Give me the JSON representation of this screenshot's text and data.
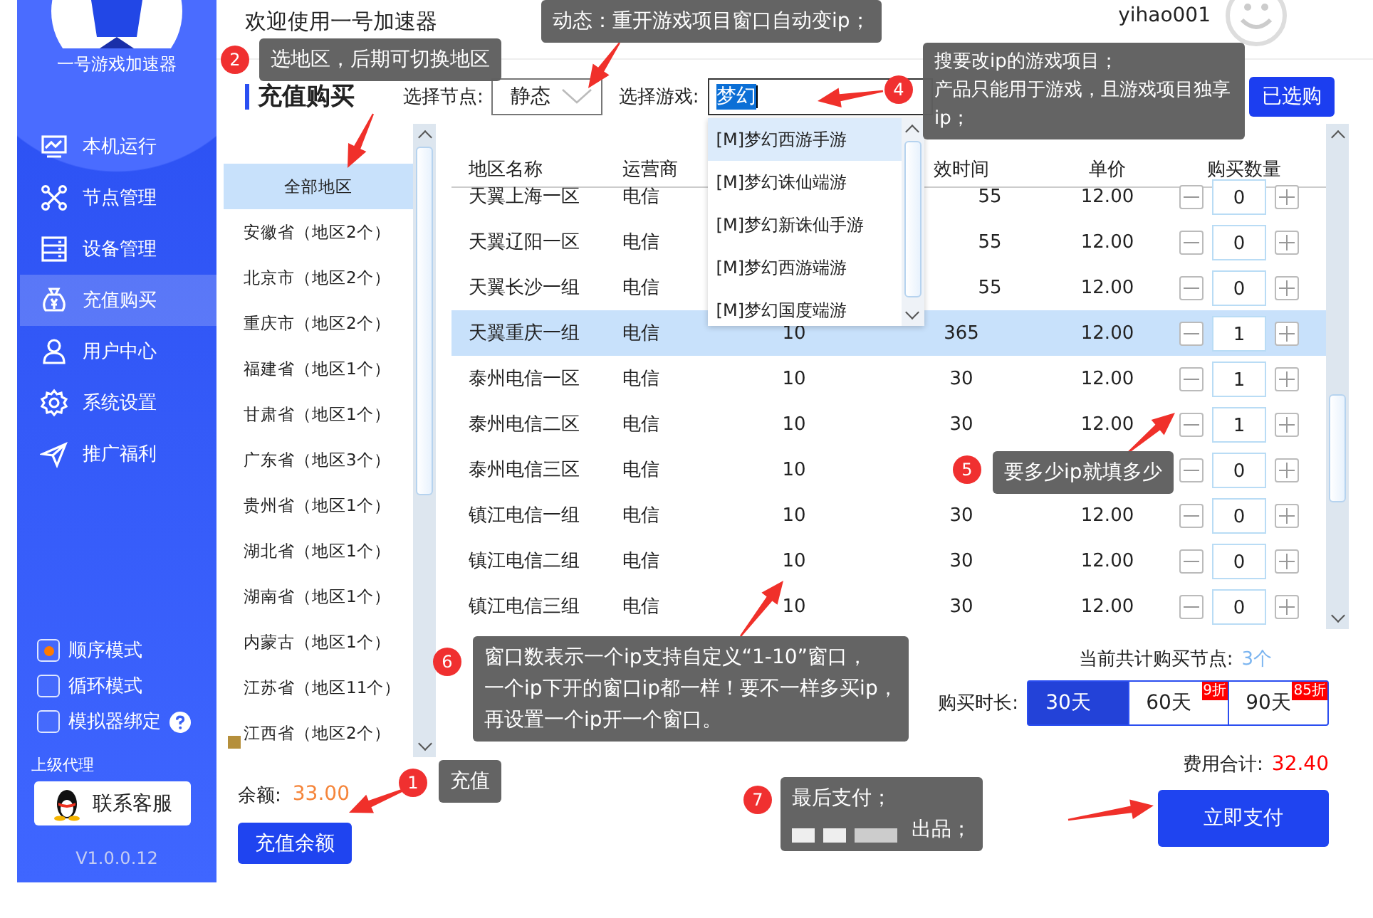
{
  "sidebar": {
    "app_name": "一号游戏加速器",
    "nav": [
      {
        "label": "本机运行",
        "selected": false
      },
      {
        "label": "节点管理",
        "selected": false
      },
      {
        "label": "设备管理",
        "selected": false
      },
      {
        "label": "充值购买",
        "selected": true
      },
      {
        "label": "用户中心",
        "selected": false
      },
      {
        "label": "系统设置",
        "selected": false
      },
      {
        "label": "推广福利",
        "selected": false
      }
    ],
    "options": [
      {
        "label": "顺序模式",
        "kind": "radio",
        "checked": true,
        "help": false
      },
      {
        "label": "循环模式",
        "kind": "checkbox",
        "checked": false,
        "help": false
      },
      {
        "label": "模拟器绑定",
        "kind": "checkbox",
        "checked": false,
        "help": true
      }
    ],
    "agent_label": "上级代理",
    "contact_button": "联系客服",
    "version": "V1.0.0.12"
  },
  "header": {
    "welcome": "欢迎使用一号加速器",
    "username": "yihao001"
  },
  "page_title": "充值购买",
  "filters": {
    "node_label": "选择节点:",
    "node_value": "静态",
    "game_label": "选择游戏:",
    "game_value": "梦幻",
    "selected_button": "已选购"
  },
  "game_suggestions": [
    {
      "label": "[M]梦幻西游手游",
      "selected": true
    },
    {
      "label": "[M]梦幻诛仙端游",
      "selected": false
    },
    {
      "label": "[M]梦幻新诛仙手游",
      "selected": false
    },
    {
      "label": "[M]梦幻西游端游",
      "selected": false
    },
    {
      "label": "[M]梦幻国度端游",
      "selected": false
    }
  ],
  "regions": [
    {
      "label": "全部地区",
      "selected": true
    },
    {
      "label": "安徽省（地区2个）",
      "selected": false
    },
    {
      "label": "北京市（地区2个）",
      "selected": false
    },
    {
      "label": "重庆市（地区2个）",
      "selected": false
    },
    {
      "label": "福建省（地区1个）",
      "selected": false
    },
    {
      "label": "甘肃省（地区1个）",
      "selected": false
    },
    {
      "label": "广东省（地区3个）",
      "selected": false
    },
    {
      "label": "贵州省（地区1个）",
      "selected": false
    },
    {
      "label": "湖北省（地区1个）",
      "selected": false
    },
    {
      "label": "湖南省（地区1个）",
      "selected": false
    },
    {
      "label": "内蒙古（地区1个）",
      "selected": false
    },
    {
      "label": "江苏省（地区11个）",
      "selected": false
    },
    {
      "label": "江西省（地区2个）",
      "selected": false
    }
  ],
  "balance": {
    "label": "余额:",
    "value": "33.00",
    "button": "充值余额"
  },
  "table": {
    "columns": [
      {
        "label": "地区名称"
      },
      {
        "label": "运营商"
      },
      {},
      {
        "label": "效时间"
      },
      {
        "label": "单价"
      },
      {
        "label": "购买数量"
      }
    ],
    "rows": [
      {
        "name": "天翼上海一区",
        "carrier": "电信",
        "duration": "55",
        "price": "12.00",
        "quantity": "0",
        "selected": false
      },
      {
        "name": "天翼辽阳一区",
        "carrier": "电信",
        "duration": "55",
        "price": "12.00",
        "quantity": "0",
        "selected": false
      },
      {
        "name": "天翼长沙一组",
        "carrier": "电信",
        "duration": "55",
        "price": "12.00",
        "quantity": "0",
        "selected": false
      },
      {
        "name": "天翼重庆一组",
        "carrier": "电信",
        "windows": "10",
        "duration": "365",
        "price": "12.00",
        "quantity": "1",
        "selected": true
      },
      {
        "name": "泰州电信一区",
        "carrier": "电信",
        "windows": "10",
        "duration": "30",
        "price": "12.00",
        "quantity": "1",
        "selected": false
      },
      {
        "name": "泰州电信二区",
        "carrier": "电信",
        "windows": "10",
        "duration": "30",
        "price": "12.00",
        "quantity": "1",
        "selected": false
      },
      {
        "name": "泰州电信三区",
        "carrier": "电信",
        "windows": "10",
        "quantity": "0",
        "selected": false
      },
      {
        "name": "镇江电信一组",
        "carrier": "电信",
        "windows": "10",
        "duration": "30",
        "price": "12.00",
        "quantity": "0",
        "selected": false
      },
      {
        "name": "镇江电信二组",
        "carrier": "电信",
        "windows": "10",
        "duration": "30",
        "price": "12.00",
        "quantity": "0",
        "selected": false
      },
      {
        "name": "镇江电信三组",
        "carrier": "电信",
        "windows": "10",
        "duration": "30",
        "price": "12.00",
        "quantity": "0",
        "selected": false
      }
    ]
  },
  "summary": {
    "nodes_label": "当前共计购买节点:",
    "nodes_value": "3个",
    "duration_label": "购买时长:",
    "durations": [
      {
        "label": "30天",
        "selected": true
      },
      {
        "label": "60天",
        "selected": false,
        "badge": "9折"
      },
      {
        "label": "90天",
        "selected": false,
        "badge": "85折"
      }
    ],
    "total_label": "费用合计:",
    "total_value": "32.40",
    "pay_button": "立即支付"
  },
  "callouts": [
    {
      "lines": [
        "动态：重开游戏项目窗口自动变ip；"
      ]
    },
    {
      "number": "2",
      "lines": [
        "选地区，后期可切换地区"
      ]
    },
    {
      "number": "4",
      "lines": [
        "搜要改ip的游戏项目；",
        "产品只能用于游戏，且游戏项目独享ip；"
      ]
    },
    {
      "number": "5",
      "lines": [
        "要多少ip就填多少"
      ]
    },
    {
      "number": "6",
      "lines": [
        "窗口数表示一个ip支持自定义“1-10”窗口，",
        "一个ip下开的窗口ip都一样！要不一样多买ip，",
        "再设置一个ip开一个窗口。"
      ]
    },
    {
      "number": "1",
      "lines": [
        "充值"
      ]
    },
    {
      "number": "7",
      "lines": [
        "最后支付；",
        "出品；"
      ],
      "redacted": true
    }
  ]
}
